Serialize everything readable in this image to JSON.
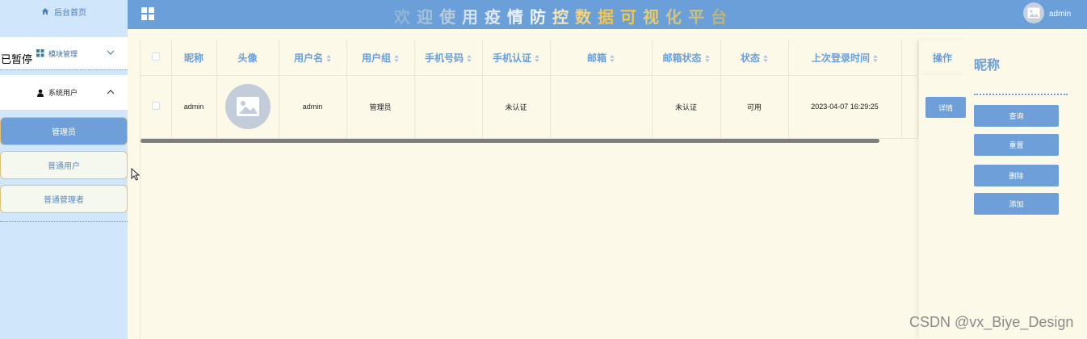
{
  "sidebar": {
    "home_label": "后台首页",
    "module_label": "模块管理",
    "system_users_label": "系统用户",
    "sub_items": [
      "管理员",
      "普通用户",
      "普通管理者"
    ],
    "overlay_text": "已暂停"
  },
  "topbar": {
    "title_chars": [
      {
        "ch": "欢",
        "color": "#8fb6d6"
      },
      {
        "ch": "迎",
        "color": "#a6c2d8"
      },
      {
        "ch": "使",
        "color": "#b9cbd8"
      },
      {
        "ch": "用",
        "color": "#d5e2ee"
      },
      {
        "ch": "疫",
        "color": "#dfe8f2"
      },
      {
        "ch": "情",
        "color": "#e9eff6"
      },
      {
        "ch": "防",
        "color": "#eef3f8"
      },
      {
        "ch": "控",
        "color": "#f3e6b8"
      },
      {
        "ch": "数",
        "color": "#f2d37a"
      },
      {
        "ch": "据",
        "color": "#f0c44d"
      },
      {
        "ch": "可",
        "color": "#f0c84e"
      },
      {
        "ch": "视",
        "color": "#e8cc6a"
      },
      {
        "ch": "化",
        "color": "#d9c57a"
      },
      {
        "ch": "平",
        "color": "#c8c07d"
      },
      {
        "ch": "台",
        "color": "#c3b66c"
      }
    ],
    "username": "admin"
  },
  "table": {
    "headers": [
      "昵称",
      "头像",
      "用户名",
      "用户组",
      "手机号码",
      "手机认证",
      "邮箱",
      "邮箱状态",
      "状态",
      "上次登录时间"
    ],
    "sortable": [
      false,
      false,
      true,
      true,
      true,
      true,
      true,
      true,
      true,
      true
    ],
    "rows": [
      {
        "nickname": "admin",
        "username": "admin",
        "group": "管理员",
        "phone": "",
        "phone_auth": "未认证",
        "email": "",
        "email_status": "未认证",
        "status": "可用",
        "last_login": "2023-04-07 16:29:25"
      }
    ],
    "ops_header": "操作",
    "detail_label": "详情"
  },
  "panel": {
    "label": "昵称",
    "buttons": [
      "查询",
      "重置",
      "删除",
      "添加"
    ]
  },
  "watermark": "CSDN @vx_Biye_Design"
}
